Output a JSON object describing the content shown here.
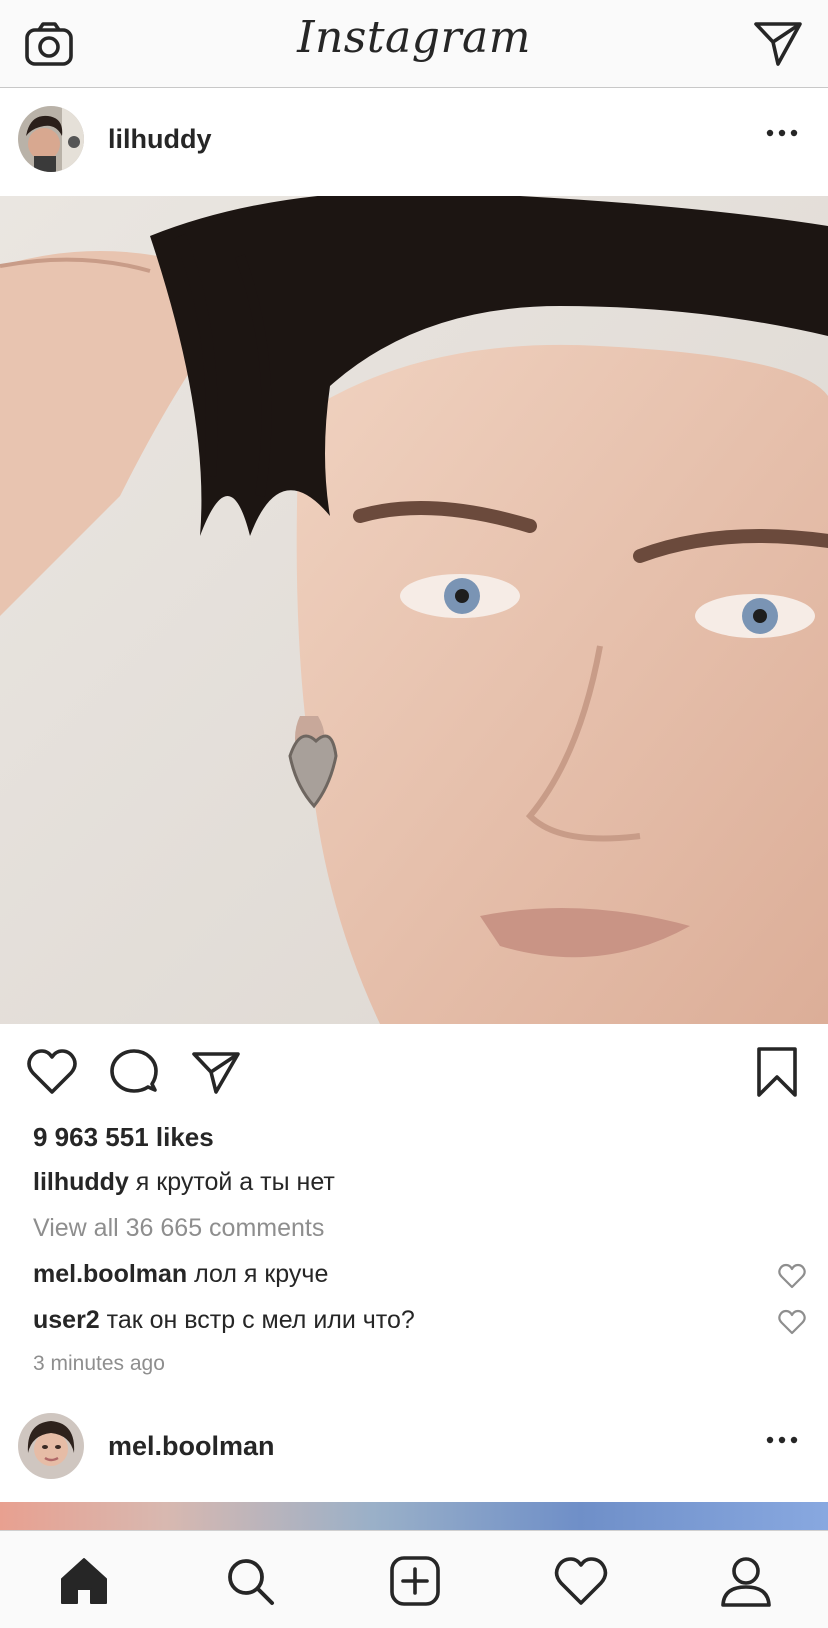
{
  "app": {
    "logo_text": "Instagram"
  },
  "posts": [
    {
      "username": "lilhuddy",
      "likes": "9 963 551 likes",
      "caption_user": "lilhuddy",
      "caption_text": " я крутой а ты нет",
      "view_comments": "View all 36 665 comments",
      "comments": [
        {
          "user": "mel.boolman",
          "text": " лол я круче"
        },
        {
          "user": "user2",
          "text": " так он встр с мел или что?"
        }
      ],
      "timestamp": "3 minutes ago"
    },
    {
      "username": "mel.boolman"
    }
  ],
  "nav": {
    "items": [
      "home-icon",
      "search-icon",
      "new-post-icon",
      "activity-icon",
      "profile-icon"
    ],
    "active": "home-icon"
  },
  "colors": {
    "text": "#262626",
    "secondary_text": "#8e8e8e",
    "bar_background": "#fafafa",
    "divider": "#c8c8c8"
  }
}
